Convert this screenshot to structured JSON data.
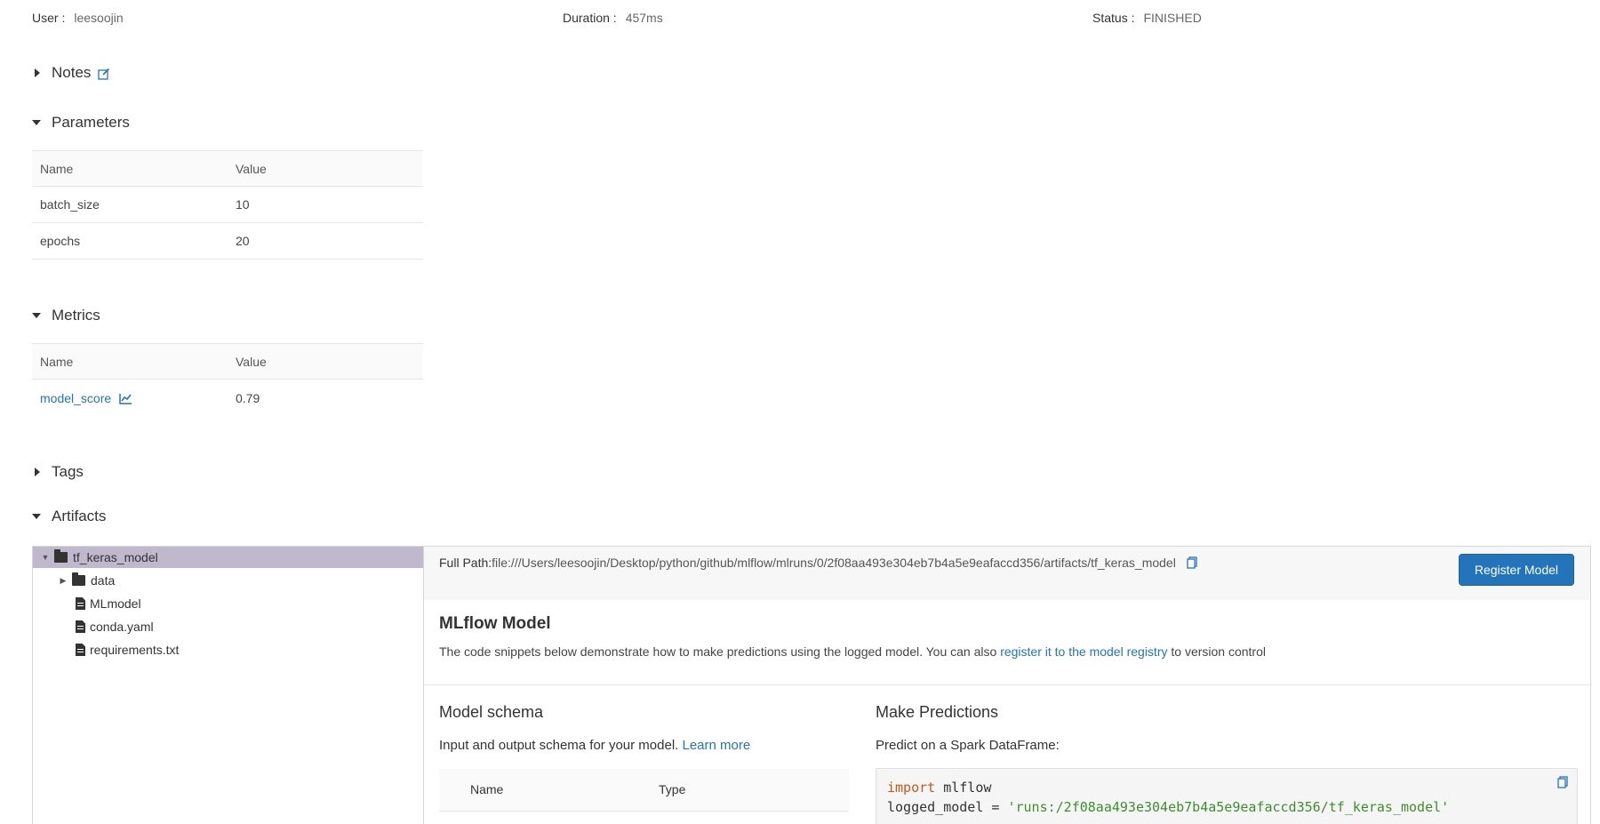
{
  "run_info": {
    "user_label": "User :",
    "user_value": "leesoojin",
    "duration_label": "Duration :",
    "duration_value": "457ms",
    "status_label": "Status :",
    "status_value": "FINISHED"
  },
  "sections": {
    "notes": "Notes",
    "parameters": "Parameters",
    "metrics": "Metrics",
    "tags": "Tags",
    "artifacts": "Artifacts"
  },
  "parameters": {
    "headers": [
      "Name",
      "Value"
    ],
    "rows": [
      {
        "name": "batch_size",
        "value": "10"
      },
      {
        "name": "epochs",
        "value": "20"
      }
    ]
  },
  "metrics": {
    "headers": [
      "Name",
      "Value"
    ],
    "rows": [
      {
        "name": "model_score",
        "value": "0.79"
      }
    ]
  },
  "artifact_tree": {
    "root": "tf_keras_model",
    "children": [
      "data",
      "MLmodel",
      "conda.yaml",
      "requirements.txt"
    ]
  },
  "artifact_detail": {
    "full_path_label": "Full Path:",
    "full_path_value": "file:///Users/leesoojin/Desktop/python/github/mlflow/mlruns/0/2f08aa493e304eb7b4a5e9eafaccd356/artifacts/tf_keras_model",
    "register_button": "Register Model",
    "model_title": "MLflow Model",
    "model_desc_prefix": "The code snippets below demonstrate how to make predictions using the logged model. You can also ",
    "model_desc_link": "register it to the model registry",
    "model_desc_suffix": " to version control",
    "schema_title": "Model schema",
    "schema_desc": "Input and output schema for your model. ",
    "schema_learn_more": "Learn more",
    "schema_headers": [
      "Name",
      "Type"
    ],
    "pred_title": "Make Predictions",
    "pred_desc": "Predict on a Spark DataFrame:",
    "code_line1_kw": "import",
    "code_line1_rest": " mlflow",
    "code_line2_prefix": "logged_model = ",
    "code_line2_str": "'runs:/2f08aa493e304eb7b4a5e9eafaccd356/tf_keras_model'"
  },
  "colors": {
    "link": "#2374bb",
    "selected_tree_row": "#c0b8cc",
    "button_bg": "#2374bb"
  }
}
